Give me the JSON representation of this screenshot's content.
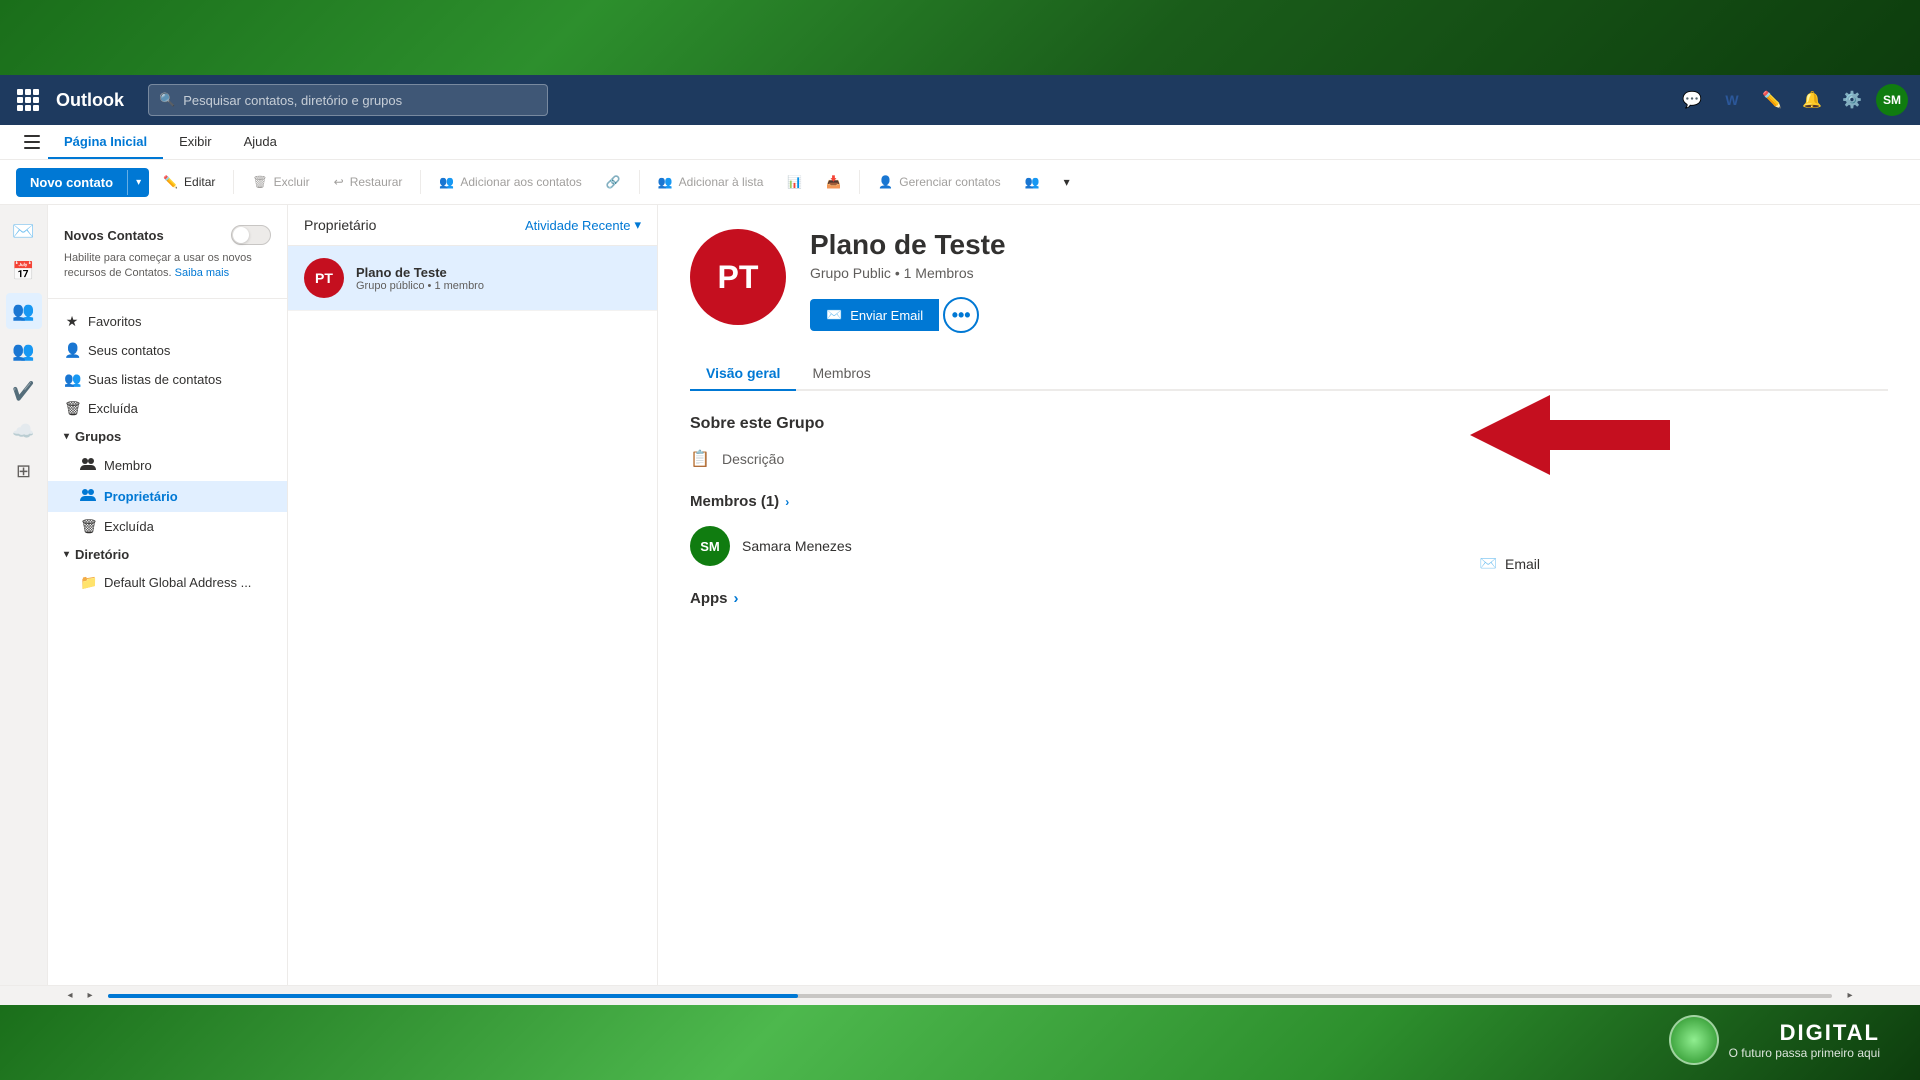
{
  "topbar": {
    "app_name": "Outlook",
    "search_placeholder": "Pesquisar contatos, diretório e grupos",
    "avatar_initials": "SM"
  },
  "ribbon": {
    "tabs": [
      "Página Inicial",
      "Exibir",
      "Ajuda"
    ],
    "active_tab": "Página Inicial",
    "buttons": {
      "novo_contato": "Novo contato",
      "editar": "Editar",
      "excluir": "Excluir",
      "restaurar": "Restaurar",
      "adicionar_contatos": "Adicionar aos contatos",
      "adicionar_lista": "Adicionar à lista",
      "gerenciar_contatos": "Gerenciar contatos"
    }
  },
  "folder_panel": {
    "novos_contatos": {
      "title": "Novos Contatos",
      "desc": "Habilite para começar a usar os novos recursos de Contatos.",
      "link_text": "Saiba mais"
    },
    "items": [
      {
        "label": "Favoritos",
        "icon": "★",
        "level": 0
      },
      {
        "label": "Seus contatos",
        "icon": "👤",
        "level": 0
      },
      {
        "label": "Suas listas de contatos",
        "icon": "👥",
        "level": 0
      },
      {
        "label": "Excluída",
        "icon": "🗑",
        "level": 0
      },
      {
        "label": "Grupos",
        "icon": "",
        "section": true
      },
      {
        "label": "Membro",
        "icon": "👥",
        "level": 1
      },
      {
        "label": "Proprietário",
        "icon": "👥",
        "level": 1,
        "active": true
      },
      {
        "label": "Excluída",
        "icon": "🗑",
        "level": 1
      },
      {
        "label": "Diretório",
        "icon": "",
        "section": true
      },
      {
        "label": "Default Global Address ...",
        "icon": "📁",
        "level": 1
      }
    ]
  },
  "contact_list": {
    "owner": "Proprietário",
    "recent_activity": "Atividade Recente",
    "contacts": [
      {
        "initials": "PT",
        "name": "Plano de Teste",
        "sub": "Grupo público • 1 membro",
        "selected": true
      }
    ]
  },
  "detail": {
    "initials": "PT",
    "name": "Plano de Teste",
    "subtitle": "Grupo Public • 1 Membros",
    "tabs": [
      "Visão geral",
      "Membros"
    ],
    "active_tab": "Visão geral",
    "actions": {
      "enviar_email": "Enviar Email"
    },
    "section_title": "Sobre este Grupo",
    "fields": [
      {
        "icon": "📋",
        "label": "Descrição"
      }
    ],
    "email_label": "Email",
    "members_section": "Membros (1)",
    "members": [
      {
        "initials": "SM",
        "name": "Samara Menezes"
      }
    ],
    "apps_label": "Apps"
  },
  "branding": {
    "company": "DIGITAL",
    "tagline": "O futuro passa primeiro aqui"
  }
}
